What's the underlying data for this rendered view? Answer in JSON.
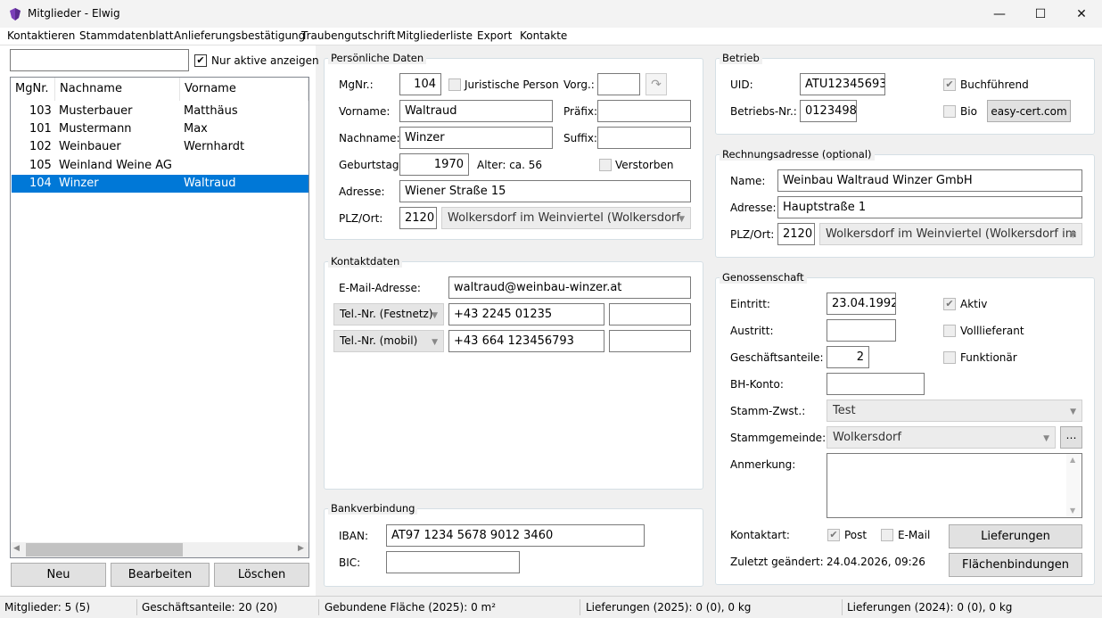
{
  "window": {
    "title": "Mitglieder - Elwig",
    "min": "—",
    "max": "☐",
    "close": "✕"
  },
  "menu": [
    "Kontaktieren",
    "Stammdatenblatt",
    "Anlieferungsbestätigung",
    "Traubengutschrift",
    "Mitgliederliste",
    "Export",
    "Kontakte"
  ],
  "left": {
    "search_value": "",
    "only_active_label": "Nur aktive anzeigen",
    "only_active_checked": "✔",
    "columns": [
      "MgNr.",
      "Nachname",
      "Vorname"
    ],
    "rows": [
      {
        "nr": "103",
        "last": "Musterbauer",
        "first": "Matthäus"
      },
      {
        "nr": "101",
        "last": "Mustermann",
        "first": "Max"
      },
      {
        "nr": "102",
        "last": "Weinbauer",
        "first": "Wernhardt"
      },
      {
        "nr": "105",
        "last": "Weinland Weine AG",
        "first": ""
      },
      {
        "nr": "104",
        "last": "Winzer",
        "first": "Waltraud"
      }
    ],
    "buttons": {
      "new": "Neu",
      "edit": "Bearbeiten",
      "delete": "Löschen"
    }
  },
  "personal": {
    "title": "Persönliche Daten",
    "mgnr_label": "MgNr.:",
    "mgnr": "104",
    "legal_label": "Juristische Person",
    "vorg_label": "Vorg.:",
    "vorg": "",
    "first_label": "Vorname:",
    "first": "Waltraud",
    "prefix_label": "Präfix:",
    "prefix": "",
    "last_label": "Nachname:",
    "last": "Winzer",
    "suffix_label": "Suffix:",
    "suffix": "",
    "birth_label": "Geburtstag:",
    "birth": "1970",
    "age": "Alter: ca. 56",
    "deceased_label": "Verstorben",
    "address_label": "Adresse:",
    "address": "Wiener Straße 15",
    "plz_label": "PLZ/Ort:",
    "plz": "2120",
    "city": "Wolkersdorf im Weinviertel (Wolkersdorf"
  },
  "contact": {
    "title": "Kontaktdaten",
    "email_label": "E-Mail-Adresse:",
    "email": "waltraud@weinbau-winzer.at",
    "phone1_type": "Tel.-Nr. (Festnetz)",
    "phone1": "+43 2245 01235",
    "phone1_note": "",
    "phone2_type": "Tel.-Nr. (mobil)",
    "phone2": "+43 664 123456793",
    "phone2_note": ""
  },
  "bank": {
    "title": "Bankverbindung",
    "iban_label": "IBAN:",
    "iban": "AT97 1234 5678 9012 3460",
    "bic_label": "BIC:",
    "bic": ""
  },
  "business": {
    "title": "Betrieb",
    "uid_label": "UID:",
    "uid": "ATU12345693",
    "bookkeeping_label": "Buchführend",
    "bookkeeping_checked": "✔",
    "nr_label": "Betriebs-Nr.:",
    "nr": "0123498",
    "bio_label": "Bio",
    "bio_button": "easy-cert.com"
  },
  "billing": {
    "title": "Rechnungsadresse (optional)",
    "name_label": "Name:",
    "name": "Weinbau Waltraud Winzer GmbH",
    "address_label": "Adresse:",
    "address": "Hauptstraße 1",
    "plz_label": "PLZ/Ort:",
    "plz": "2120",
    "city": "Wolkersdorf im Weinviertel (Wolkersdorf im"
  },
  "coop": {
    "title": "Genossenschaft",
    "entry_label": "Eintritt:",
    "entry": "23.04.1992",
    "active_label": "Aktiv",
    "active_checked": "✔",
    "exit_label": "Austritt:",
    "exit": "",
    "full_label": "Volllieferant",
    "shares_label": "Geschäftsanteile:",
    "shares": "2",
    "func_label": "Funktionär",
    "bh_label": "BH-Konto:",
    "bh": "",
    "branch_label": "Stamm-Zwst.:",
    "branch": "Test",
    "community_label": "Stammgemeinde:",
    "community": "Wolkersdorf",
    "more_button": "⋯",
    "note_label": "Anmerkung:",
    "note": "",
    "contact_label": "Kontaktart:",
    "post_label": "Post",
    "post_checked": "✔",
    "email_label": "E-Mail",
    "deliveries_button": "Lieferungen",
    "changed_label": "Zuletzt geändert:",
    "changed": "24.04.2026, 09:26",
    "areas_button": "Flächenbindungen"
  },
  "status": [
    "Mitglieder: 5 (5)",
    "Geschäftsanteile: 20 (20)",
    "Gebundene Fläche (2025): 0 m²",
    "Lieferungen (2025): 0 (0), 0 kg",
    "Lieferungen (2024): 0 (0), 0 kg"
  ]
}
